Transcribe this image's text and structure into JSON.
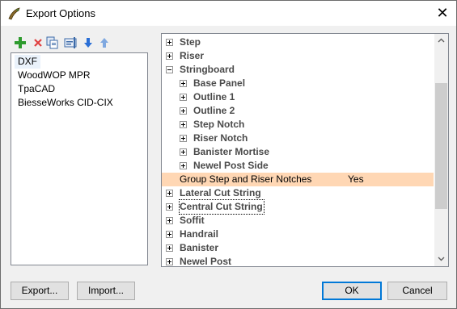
{
  "window": {
    "title": "Export Options",
    "close_glyph": "✕"
  },
  "toolbar": {
    "icons": [
      "add-icon",
      "delete-icon",
      "copy-icon",
      "properties-icon",
      "move-down-icon",
      "move-up-icon"
    ]
  },
  "formats": {
    "items": [
      "DXF",
      "WoodWOP MPR",
      "TpaCAD",
      "BiesseWorks CID-CIX"
    ],
    "selected": "DXF"
  },
  "tree": {
    "rows": [
      {
        "label": "Step",
        "value": "",
        "expanded": false
      },
      {
        "label": "Riser",
        "value": "",
        "expanded": false
      },
      {
        "label": "Stringboard",
        "value": "",
        "expanded": true
      },
      {
        "label": "Base Panel",
        "value": "",
        "expanded": false
      },
      {
        "label": "Outline 1",
        "value": "",
        "expanded": false
      },
      {
        "label": "Outline 2",
        "value": "",
        "expanded": false
      },
      {
        "label": "Step Notch",
        "value": "",
        "expanded": false
      },
      {
        "label": "Riser Notch",
        "value": "",
        "expanded": false
      },
      {
        "label": "Banister Mortise",
        "value": "",
        "expanded": false
      },
      {
        "label": "Newel Post Side",
        "value": "",
        "expanded": false
      },
      {
        "label": "Group Step and Riser Notches",
        "value": "Yes",
        "expanded": null
      },
      {
        "label": "Lateral Cut String",
        "value": "",
        "expanded": false
      },
      {
        "label": "Central Cut String",
        "value": "",
        "expanded": false
      },
      {
        "label": "Soffit",
        "value": "",
        "expanded": false
      },
      {
        "label": "Handrail",
        "value": "",
        "expanded": false
      },
      {
        "label": "Banister",
        "value": "",
        "expanded": false
      },
      {
        "label": "Newel Post",
        "value": "",
        "expanded": false
      }
    ],
    "highlighted_row": "Group Step and Riser Notches",
    "focused_row": "Central Cut String"
  },
  "colors": {
    "highlight": "#ffd7b4",
    "selection": "#eaf2fb",
    "accent": "#0078d7"
  },
  "buttons": {
    "export": "Export...",
    "import": "Import...",
    "ok": "OK",
    "cancel": "Cancel"
  }
}
